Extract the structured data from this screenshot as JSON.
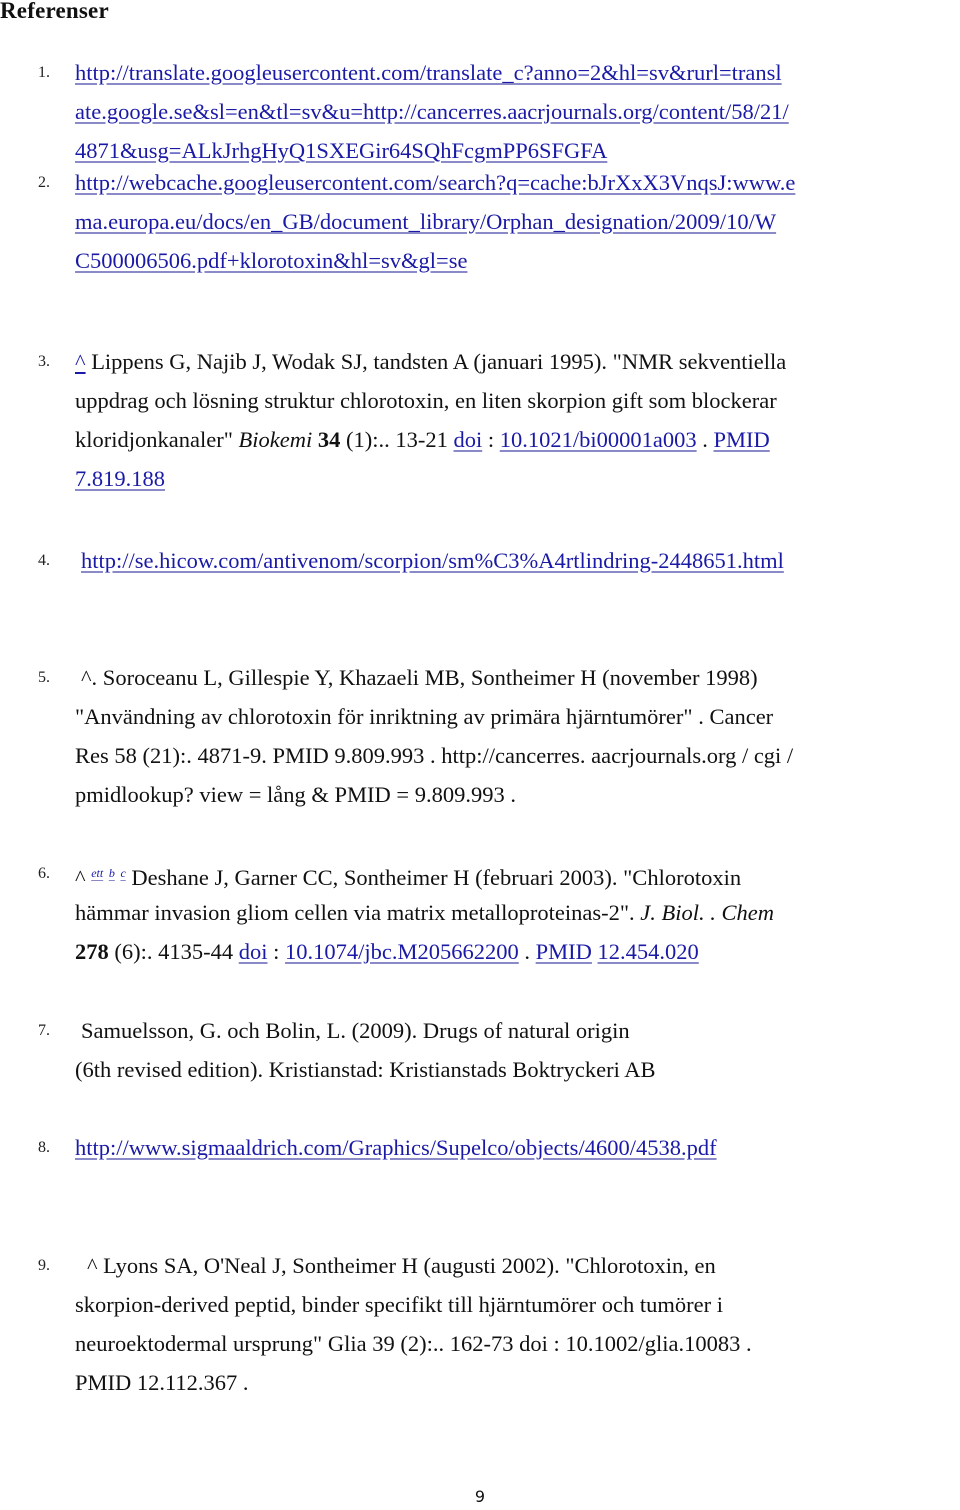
{
  "heading": "Referenser",
  "page_number": "9",
  "references": [
    {
      "number": "1.",
      "lines": [
        "http://translate.googleusercontent.com/translate_c?anno=2&hl=sv&rurl=transl",
        "ate.google.se&sl=en&tl=sv&u=http://cancerres.aacrjournals.org/content/58/21/",
        "4871&usg=ALkJrhgHyQ1SXEGir64SQhFcgmPP6SFGFA"
      ]
    },
    {
      "number": "2.",
      "lines": [
        "http://webcache.googleusercontent.com/search?q=cache:bJrXxX3VnqsJ:www.e",
        "ma.europa.eu/docs/en_GB/document_library/Orphan_designation/2009/10/W",
        "C500006506.pdf+klorotoxin&hl=sv&gl=se"
      ]
    },
    {
      "number": "3.",
      "caret": "^",
      "line1": "Lippens G, Najib J, Wodak SJ, tandsten A (januari 1995).  \"NMR sekventiella",
      "line2": "uppdrag och lösning struktur chlorotoxin, en liten skorpion gift som blockerar",
      "line3_text": "kloridjonkanaler\" ",
      "journal": "Biokemi",
      "volume": "34",
      "issue_pages": " (1):.. 13-21 ",
      "doi_label": "doi",
      "sep": " : ",
      "doi_value": "10.1021/bi00001a003",
      "dot": " . ",
      "pmid_label": "PMID",
      "pmid_value": "7.819.188"
    },
    {
      "number": "4.",
      "url": "http://se.hicow.com/antivenom/scorpion/sm%C3%A4rtlindring-2448651.html"
    },
    {
      "number": "5.",
      "lines": [
        "^. Soroceanu L, Gillespie Y, Khazaeli MB, Sontheimer H (november 1998)",
        "\"Användning av chlorotoxin för inriktning av primära hjärntumörer\" . Cancer",
        "Res 58 (21):. 4871-9. PMID 9.809.993 . http://cancerres. aacrjournals.org / cgi /",
        "pmidlookup? view = lång & PMID = 9.809.993 ."
      ]
    },
    {
      "number": "6.",
      "caret": "^",
      "sup_links": [
        "ett",
        "b",
        "c"
      ],
      "line1": " Deshane J, Garner CC, Sontheimer H (februari 2003).  \"Chlorotoxin",
      "line2_text": "hämmar invasion gliom cellen via matrix metalloproteinas-2\". ",
      "journal": "J.  Biol.  . Chem",
      "volume": "278",
      "issue_pages": " (6):. 4135-44 ",
      "doi_label": "doi",
      "sep": " : ",
      "doi_value": "10.1074/jbc.M205662200",
      "dot": " . ",
      "pmid_label": "PMID",
      "pmid_value": "12.454.020"
    },
    {
      "number": "7.",
      "lines": [
        "Samuelsson, G. och Bolin, L. (2009). Drugs of natural origin",
        "(6th revised edition). Kristianstad: Kristianstads Boktryckeri AB"
      ]
    },
    {
      "number": "8.",
      "url": "http://www.sigmaaldrich.com/Graphics/Supelco/objects/4600/4538.pdf"
    },
    {
      "number": "9.",
      "lines": [
        "^ Lyons SA, O'Neal J, Sontheimer H (augusti 2002).  \"Chlorotoxin, en",
        "skorpion-derived peptid, binder specifikt till hjärntumörer och tumörer i",
        "neuroektodermal ursprung\" Glia 39 (2):.. 162-73 doi : 10.1002/glia.10083 .",
        "PMID 12.112.367 ."
      ]
    }
  ]
}
